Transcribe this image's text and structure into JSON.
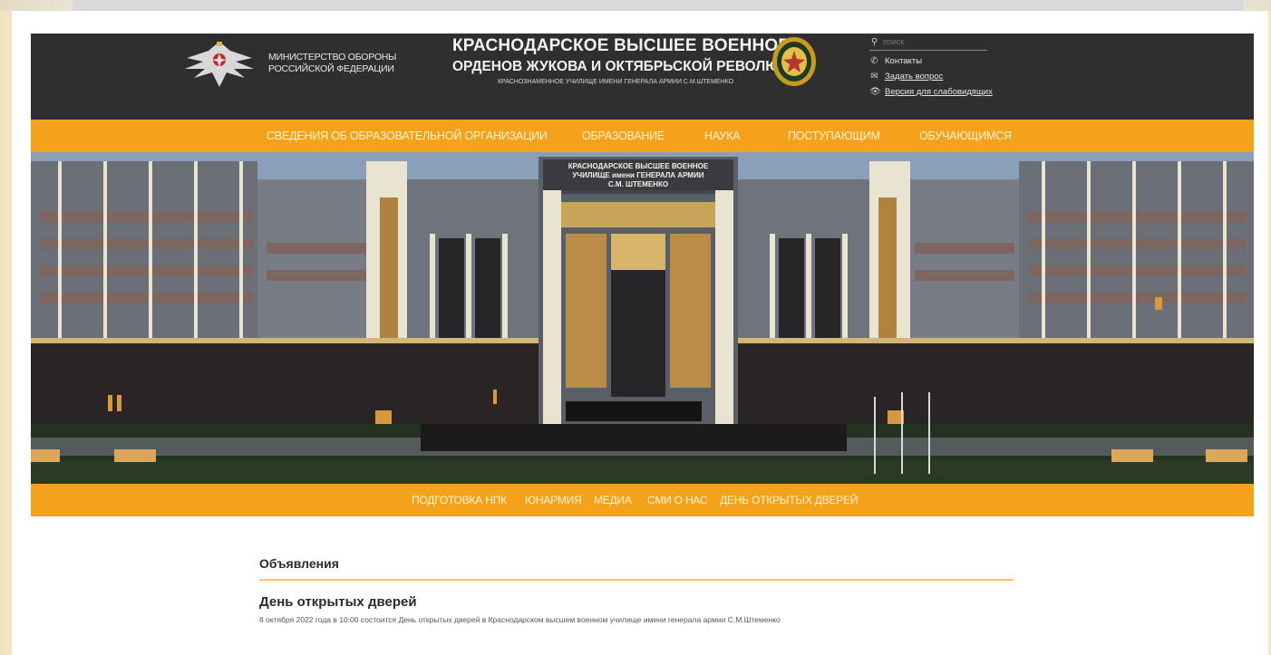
{
  "header": {
    "ministry_line1": "МИНИСТЕРСТВО ОБОРОНЫ",
    "ministry_line2": "РОССИЙСКОЙ ФЕДЕРАЦИИ",
    "title_line1": "КРАСНОДАРСКОЕ ВЫСШЕЕ ВОЕННОЕ",
    "title_line2": "ОРДЕНОВ ЖУКОВА И ОКТЯБРЬСКОЙ РЕВОЛЮЦИИ",
    "title_line3": "КРАСНОЗНАМЕННОЕ УЧИЛИЩЕ ИМЕНИ ГЕНЕРАЛА АРМИИ С.М.ШТЕМЕНКО",
    "search_placeholder": "поиск",
    "contacts_label": "Контакты",
    "ask_label": "Задать вопрос",
    "accessible_label": "Версия для слабовидящих"
  },
  "nav": {
    "items": [
      "СВЕДЕНИЯ ОБ ОБРАЗОВАТЕЛЬНОЙ ОРГАНИЗАЦИИ",
      "ОБРАЗОВАНИЕ",
      "НАУКА",
      "ПОСТУПАЮЩИМ",
      "ОБУЧАЮЩИМСЯ"
    ]
  },
  "hero": {
    "sign_line1": "КРАСНОДАРСКОЕ ВЫСШЕЕ ВОЕННОЕ",
    "sign_line2": "УЧИЛИЩЕ имени ГЕНЕРАЛА АРМИИ",
    "sign_line3": "С.М. ШТЕМЕНКО"
  },
  "nav2": {
    "items": [
      "ПОДГОТОВКА НПК",
      "ЮНАРМИЯ",
      "МЕДИА",
      "СМИ О НАС",
      "ДЕНЬ ОТКРЫТЫХ ДВЕРЕЙ"
    ]
  },
  "content": {
    "section_title": "Объявления",
    "announcement_title": "День открытых дверей",
    "announcement_text": "8 октября 2022 года в 10:00 состоится День открытых дверей в Краснодарском высшем военном училище имени генерала армии С.М.Штеменко"
  },
  "colors": {
    "header_bg": "#2f2f2f",
    "accent": "#f4a21b",
    "divider": "#f6c15e"
  }
}
